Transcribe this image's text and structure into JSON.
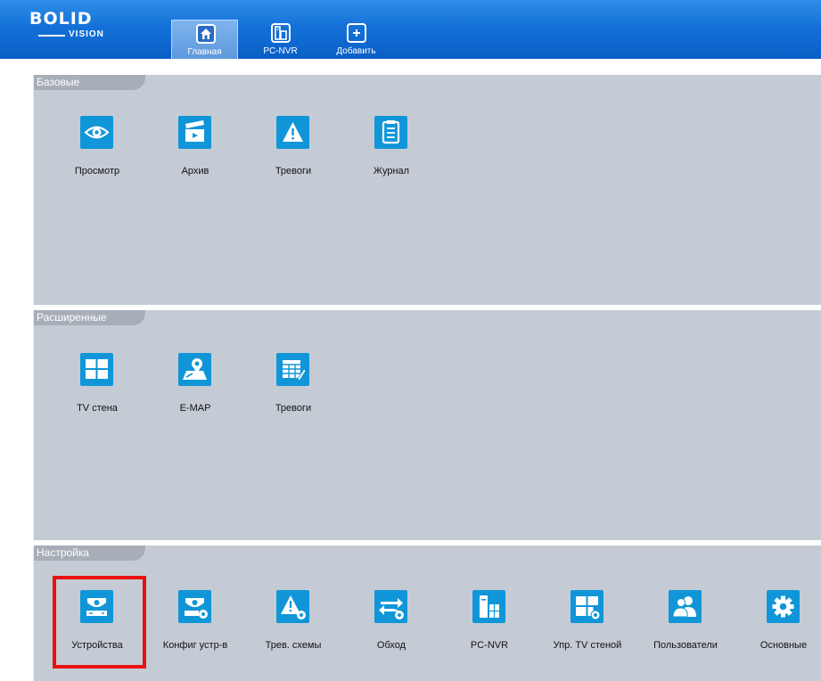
{
  "logo": {
    "top": "BOLID",
    "bottom": "VISION"
  },
  "nav": {
    "tabs": [
      {
        "label": "Главная",
        "icon": "home-icon",
        "active": true
      },
      {
        "label": "PC-NVR",
        "icon": "pc-nvr-icon",
        "active": false
      },
      {
        "label": "Добавить",
        "icon": "plus-icon",
        "active": false
      }
    ]
  },
  "sections": {
    "basic": {
      "title": "Базовые",
      "items": [
        {
          "label": "Просмотр",
          "icon": "eye-icon"
        },
        {
          "label": "Архив",
          "icon": "clapperboard-icon"
        },
        {
          "label": "Тревоги",
          "icon": "warning-icon"
        },
        {
          "label": "Журнал",
          "icon": "clipboard-icon"
        }
      ]
    },
    "advanced": {
      "title": "Расширенные",
      "items": [
        {
          "label": "TV стена",
          "icon": "video-wall-icon"
        },
        {
          "label": "E-MAP",
          "icon": "map-pin-icon"
        },
        {
          "label": "Тревоги",
          "icon": "table-edit-icon"
        }
      ]
    },
    "settings": {
      "title": "Настройка",
      "items": [
        {
          "label": "Устройства",
          "icon": "camera-device-icon"
        },
        {
          "label": "Конфиг устр-в",
          "icon": "camera-config-icon"
        },
        {
          "label": "Трев. схемы",
          "icon": "alarm-scheme-icon"
        },
        {
          "label": "Обход",
          "icon": "tour-icon"
        },
        {
          "label": "PC-NVR",
          "icon": "pc-nvr-config-icon"
        },
        {
          "label": "Упр. TV стеной",
          "icon": "video-wall-config-icon"
        },
        {
          "label": "Пользователи",
          "icon": "users-icon"
        },
        {
          "label": "Основные",
          "icon": "gear-icon"
        }
      ]
    }
  },
  "colors": {
    "topbar": "#1471d8",
    "tile_icon": "#1096d8",
    "section_bg": "#c5cbd4",
    "section_tab": "#a7aeb8",
    "highlight": "#ea1111"
  }
}
